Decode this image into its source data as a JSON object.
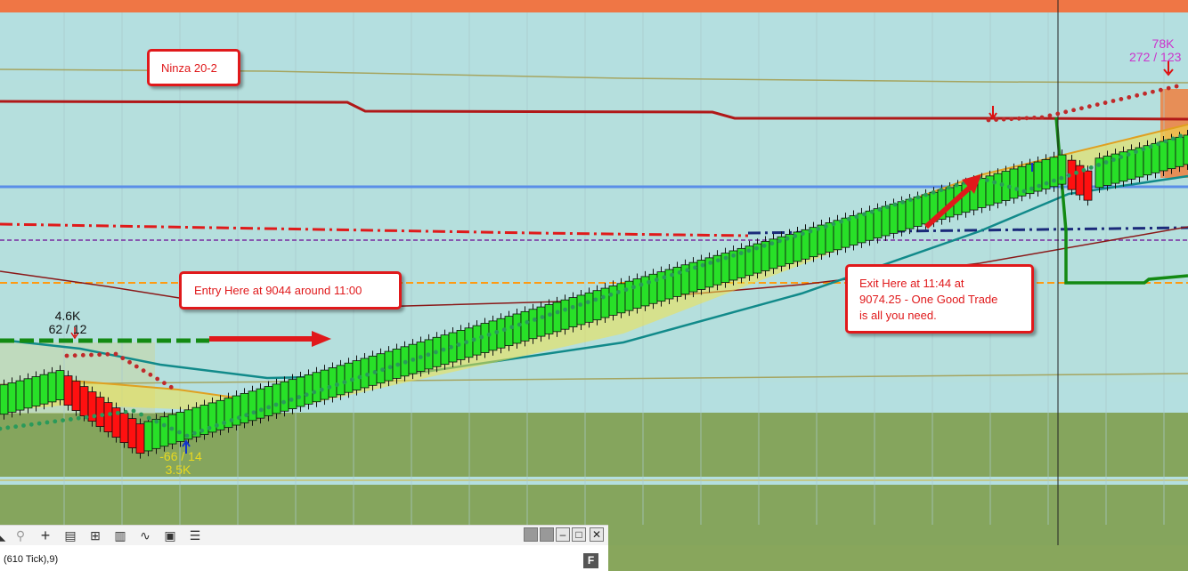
{
  "annotations": {
    "ninza": "Ninza 20-2",
    "entry": "Entry Here at  9044 around 11:00",
    "exit_line1": "Exit Here at 11:44 at",
    "exit_line2": "9074.25  - One Good Trade",
    "exit_line3": "is all you need."
  },
  "bar_labels": {
    "left_volume": "4.6K",
    "left_delta": "62 / 12",
    "low_delta": "-66 / 14",
    "low_volume": "3.5K",
    "right_volume": "78K",
    "right_delta": "272 / 123"
  },
  "toolbar": {
    "series_label": "(610 Tick),9)",
    "f_button": "F",
    "icons": [
      "zoom-out-icon",
      "crosshair-icon",
      "data-box-icon",
      "chart-style-icon",
      "bar-type-icon",
      "indicators-icon",
      "strategies-icon",
      "properties-icon"
    ]
  },
  "colors": {
    "bull_bar": "#28e028",
    "bear_bar": "#ff1010",
    "resistance_line": "#b01818",
    "blue_level": "#5a8ee8",
    "zone_green": "#85a55d",
    "top_band": "#ef7645",
    "annotation_red": "#e0191b"
  },
  "chart_data": {
    "type": "candlestick",
    "description": "Renko-style price bars rising from an entry near 9044 to an exit near 9074.25",
    "trade": {
      "entry_price": 9044,
      "entry_time": "11:00",
      "exit_price": 9074.25,
      "exit_time": "11:44"
    },
    "bars_start": [
      {
        "dir": "up",
        "count": 8
      },
      {
        "dir": "down",
        "count": 10
      },
      {
        "dir": "up",
        "count": 115
      },
      {
        "dir": "down",
        "count": 3
      },
      {
        "dir": "up",
        "count": 22
      },
      {
        "dir": "down",
        "count": 5
      }
    ]
  }
}
